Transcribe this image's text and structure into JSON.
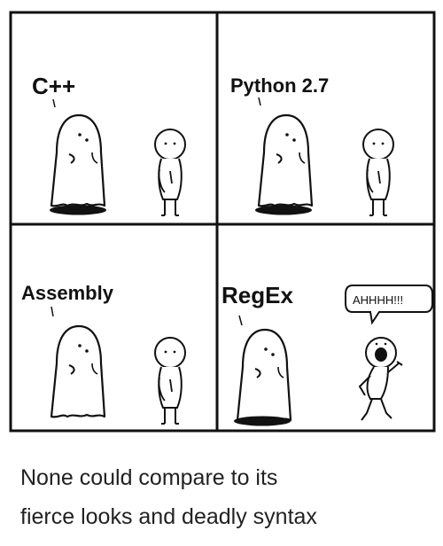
{
  "panels": [
    {
      "label": "C++"
    },
    {
      "label": "Python 2.7"
    },
    {
      "label": "Assembly"
    },
    {
      "label": "RegEx",
      "speech": "AHHHH!!!"
    }
  ],
  "caption": {
    "line1": "None could compare to its",
    "line2": "fierce looks and deadly syntax"
  }
}
